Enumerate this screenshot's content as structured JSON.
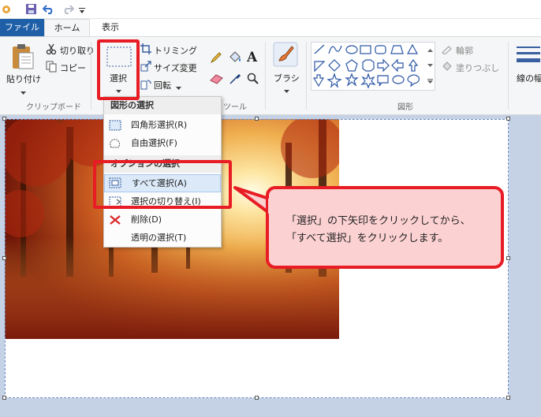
{
  "tabs": {
    "file": "ファイル",
    "home": "ホーム",
    "view": "表示"
  },
  "clipboard": {
    "paste": "貼り付け",
    "cut": "切り取り",
    "copy": "コピー",
    "group_label": "クリップボード"
  },
  "image": {
    "select": "選択",
    "trim": "トリミング",
    "resize": "サイズ変更",
    "rotate": "回転"
  },
  "tools": {
    "group_label": "ツール"
  },
  "brush": {
    "label": "ブラシ"
  },
  "shapes": {
    "outline": "輪郭",
    "fill": "塗りつぶし",
    "group_label": "図形",
    "line_width": "線の幅"
  },
  "menu": {
    "header_shape": "図形の選択",
    "rect_select": "四角形選択(R)",
    "free_select": "自由選択(F)",
    "header_options": "オプションの選択",
    "select_all": "すべて選択(A)",
    "invert": "選択の切り替え(I)",
    "delete": "削除(D)",
    "transparent": "透明の選択(T)"
  },
  "callout": {
    "line1": "「選択」の下矢印をクリックしてから、",
    "line2": "「すべて選択」をクリックします。"
  },
  "colors": {
    "annotation": "#e81c24",
    "callout_bg": "#fcd1d2",
    "file_tab": "#1e5fa8"
  },
  "icons": [
    "save-icon",
    "undo-icon",
    "redo-icon",
    "paste-icon",
    "cut-icon",
    "copy-icon",
    "select-icon",
    "crop-icon",
    "resize-icon",
    "rotate-icon",
    "pencil-icon",
    "fill-icon",
    "text-icon",
    "eraser-icon",
    "picker-icon",
    "magnifier-icon",
    "brush-icon"
  ]
}
